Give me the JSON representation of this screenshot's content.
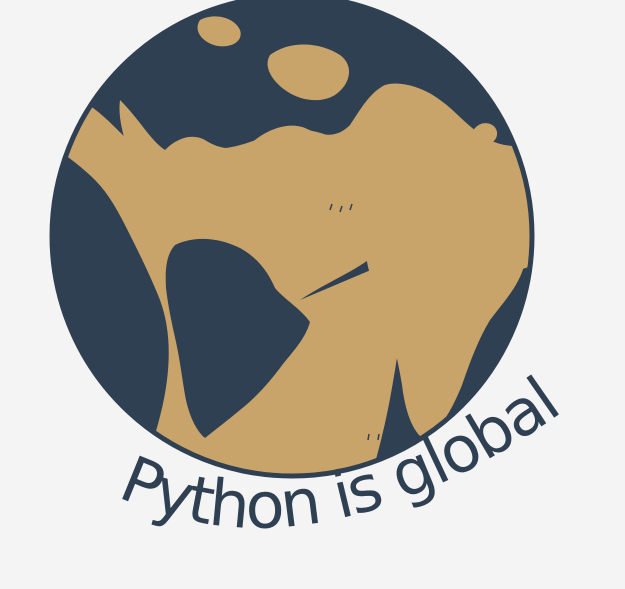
{
  "tagline": "Python is global",
  "globe": {
    "label": "globe-illustration"
  },
  "colors": {
    "background": "#f4f4f5",
    "ocean": "#2f4052",
    "land": "#c9a46a",
    "outline": "#2f4052",
    "text": "#2f4052"
  }
}
